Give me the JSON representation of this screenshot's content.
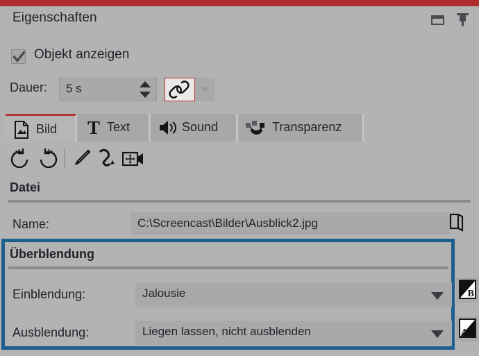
{
  "theme": {
    "accent_red": "#b02b2b",
    "panel_bg": "#b3b3b3",
    "field_bg": "#a9a9a9",
    "highlight_blue": "#1d5f8f",
    "text": "#23232c"
  },
  "titlebar": {
    "title": "Eigenschaften",
    "dock_icon": "window-dock-icon",
    "pin_icon": "pin-icon"
  },
  "visibility": {
    "checkbox_label": "Objekt anzeigen",
    "checked": true
  },
  "duration": {
    "label": "Dauer:",
    "value": "5 s",
    "spinner_up_icon": "triangle-up-icon",
    "spinner_down_icon": "triangle-down-icon",
    "link_icon": "link-chain-icon",
    "link_dropdown_icon": "chevron-down-icon"
  },
  "tabs": [
    {
      "label": "Bild",
      "icon": "image-file-icon",
      "active": true
    },
    {
      "label": "Text",
      "icon": "text-T-icon",
      "active": false
    },
    {
      "label": "Sound",
      "icon": "speaker-icon",
      "active": false
    },
    {
      "label": "Transparenz",
      "icon": "transparency-icon",
      "active": false
    }
  ],
  "toolbar": [
    {
      "icon": "rotate-left-icon",
      "tip": "rotate-left"
    },
    {
      "icon": "rotate-right-icon",
      "tip": "rotate-right"
    },
    {
      "icon": "brush-icon",
      "tip": "brush"
    },
    {
      "icon": "curve-path-icon",
      "tip": "curve-path"
    },
    {
      "icon": "camera-pan-icon",
      "tip": "camera-pan"
    }
  ],
  "file_group": {
    "heading": "Datei",
    "name_label": "Name:",
    "name_value": "C:\\Screencast\\Bilder\\Ausblick2.jpg",
    "browse_icon": "folder-open-icon"
  },
  "transition_group": {
    "heading": "Überblendung",
    "fade_in": {
      "label": "Einblendung:",
      "value": "Jalousie",
      "dropdown_icon": "chevron-down-icon",
      "side_button_letter": "B",
      "side_button_icon": "fade-in-b-icon"
    },
    "fade_out": {
      "label": "Ausblendung:",
      "value": "Liegen lassen, nicht ausblenden",
      "dropdown_icon": "chevron-down-icon",
      "side_button_letter": "A",
      "side_button_icon": "fade-out-a-icon"
    }
  }
}
